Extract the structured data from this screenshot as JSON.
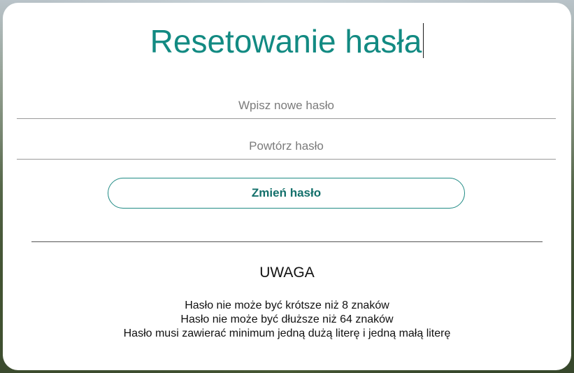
{
  "page": {
    "title": "Resetowanie hasła"
  },
  "form": {
    "new_password_placeholder": "Wpisz nowe hasło",
    "repeat_password_placeholder": "Powtórz hasło",
    "new_password_value": "",
    "repeat_password_value": "",
    "submit_label": "Zmień hasło"
  },
  "notice": {
    "heading": "UWAGA",
    "rules": [
      "Hasło nie może być krótsze niż 8 znaków",
      "Hasło nie może być dłuższe niż 64 znaków",
      "Hasło musi zawierać minimum jedną dużą literę i jedną małą literę"
    ]
  },
  "colors": {
    "accent": "#128a82",
    "button_text": "#13706b",
    "background_card": "#ffffff"
  }
}
